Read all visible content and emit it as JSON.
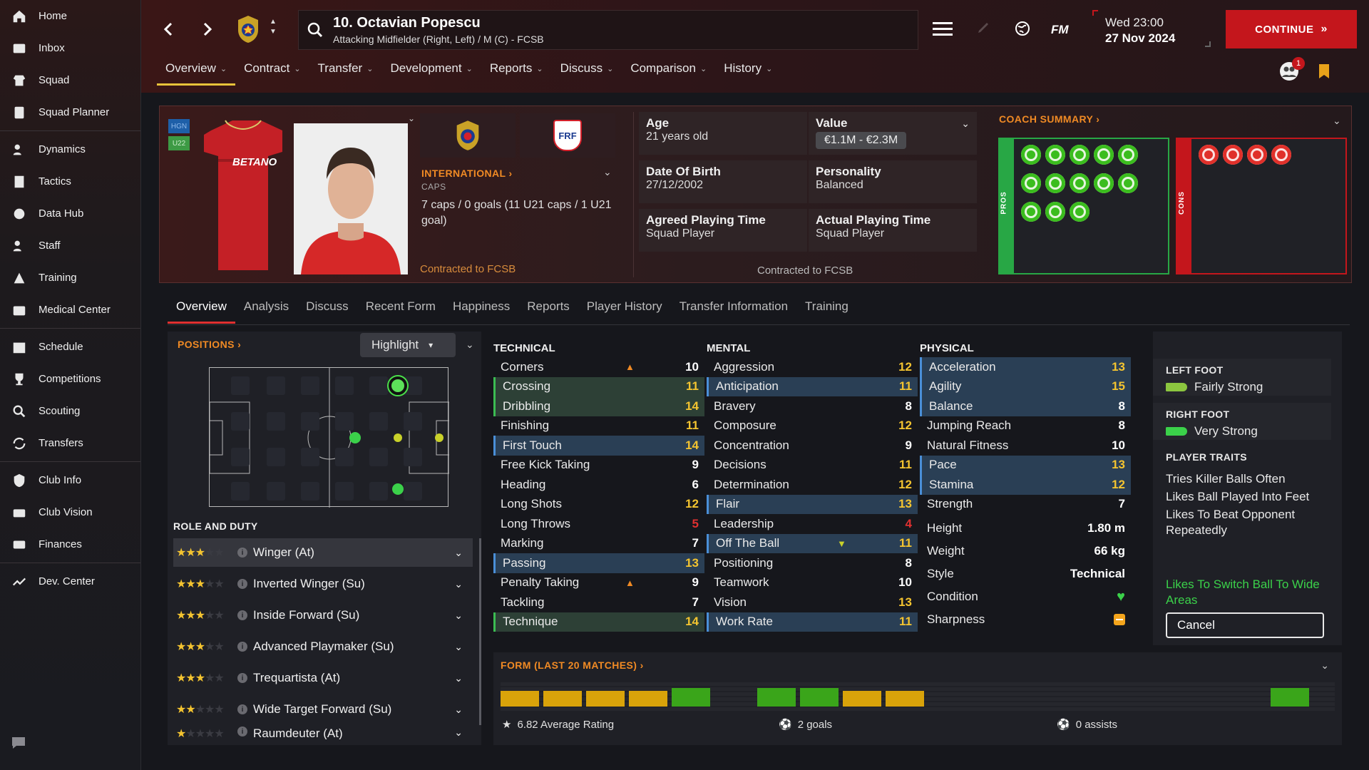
{
  "sidebar": {
    "items": [
      {
        "label": "Home",
        "icon": "home-icon"
      },
      {
        "label": "Inbox",
        "icon": "inbox-icon"
      },
      {
        "label": "Squad",
        "icon": "squad-icon"
      },
      {
        "label": "Squad Planner",
        "icon": "clipboard-icon"
      },
      {
        "label": "Dynamics",
        "icon": "dynamics-icon"
      },
      {
        "label": "Tactics",
        "icon": "tactics-icon"
      },
      {
        "label": "Data Hub",
        "icon": "data-hub-icon"
      },
      {
        "label": "Staff",
        "icon": "staff-icon"
      },
      {
        "label": "Training",
        "icon": "training-icon"
      },
      {
        "label": "Medical Center",
        "icon": "medical-icon"
      },
      {
        "label": "Schedule",
        "icon": "calendar-icon"
      },
      {
        "label": "Competitions",
        "icon": "trophy-icon"
      },
      {
        "label": "Scouting",
        "icon": "scouting-icon"
      },
      {
        "label": "Transfers",
        "icon": "transfers-icon"
      },
      {
        "label": "Club Info",
        "icon": "shield-icon"
      },
      {
        "label": "Club Vision",
        "icon": "vision-icon"
      },
      {
        "label": "Finances",
        "icon": "finances-icon"
      },
      {
        "label": "Dev. Center",
        "icon": "dev-center-icon"
      }
    ]
  },
  "header": {
    "player_name": "10. Octavian Popescu",
    "player_subtitle": "Attacking Midfielder (Right, Left) / M (C) - FCSB",
    "fm_label": "FM",
    "date_day": "Wed 23:00",
    "date_full": "27 Nov 2024",
    "continue_label": "CONTINUE",
    "notification_count": "1",
    "tabs": [
      "Overview",
      "Contract",
      "Transfer",
      "Development",
      "Reports",
      "Discuss",
      "Comparison",
      "History"
    ]
  },
  "profile": {
    "badge_hgn": "HGN",
    "badge_u22": "U22",
    "shirt_sponsor": "BETANO",
    "international_label": "INTERNATIONAL",
    "caps_label": "CAPS",
    "caps_value": "7 caps / 0 goals (11 U21 caps / 1 U21 goal)",
    "contracted_left": "Contracted to FCSB",
    "age_label": "Age",
    "age_value": "21 years old",
    "value_label": "Value",
    "value_value": "€1.1M - €2.3M",
    "dob_label": "Date Of Birth",
    "dob_value": "27/12/2002",
    "personality_label": "Personality",
    "personality_value": "Balanced",
    "agreed_pt_label": "Agreed Playing Time",
    "agreed_pt_value": "Squad Player",
    "actual_pt_label": "Actual Playing Time",
    "actual_pt_value": "Squad Player",
    "contracted_mid": "Contracted to FCSB",
    "coach_summary_label": "COACH SUMMARY",
    "pros_label": "PROS",
    "cons_label": "CONS",
    "frf_label": "FRF"
  },
  "subtabs": [
    "Overview",
    "Analysis",
    "Discuss",
    "Recent Form",
    "Happiness",
    "Reports",
    "Player History",
    "Transfer Information",
    "Training"
  ],
  "positions": {
    "label": "POSITIONS",
    "highlight_label": "Highlight",
    "role_duty_label": "ROLE AND DUTY",
    "roles": [
      {
        "name": "Winger (At)",
        "stars": 3
      },
      {
        "name": "Inverted Winger (Su)",
        "stars": 3
      },
      {
        "name": "Inside Forward (Su)",
        "stars": 3
      },
      {
        "name": "Advanced Playmaker (Su)",
        "stars": 3
      },
      {
        "name": "Trequartista (At)",
        "stars": 2.5
      },
      {
        "name": "Wide Target Forward (Su)",
        "stars": 1.5
      },
      {
        "name": "Raumdeuter (At)",
        "stars": 1
      }
    ]
  },
  "attributes": {
    "technical_label": "TECHNICAL",
    "mental_label": "MENTAL",
    "physical_label": "PHYSICAL",
    "technical": [
      {
        "name": "Corners",
        "value": "10",
        "hl": "",
        "arrow": "up"
      },
      {
        "name": "Crossing",
        "value": "11",
        "hl": "green"
      },
      {
        "name": "Dribbling",
        "value": "14",
        "hl": "green"
      },
      {
        "name": "Finishing",
        "value": "11",
        "hl": ""
      },
      {
        "name": "First Touch",
        "value": "14",
        "hl": "blue"
      },
      {
        "name": "Free Kick Taking",
        "value": "9",
        "hl": ""
      },
      {
        "name": "Heading",
        "value": "6",
        "hl": ""
      },
      {
        "name": "Long Shots",
        "value": "12",
        "hl": ""
      },
      {
        "name": "Long Throws",
        "value": "5",
        "hl": ""
      },
      {
        "name": "Marking",
        "value": "7",
        "hl": ""
      },
      {
        "name": "Passing",
        "value": "13",
        "hl": "blue"
      },
      {
        "name": "Penalty Taking",
        "value": "9",
        "hl": "",
        "arrow": "up"
      },
      {
        "name": "Tackling",
        "value": "7",
        "hl": ""
      },
      {
        "name": "Technique",
        "value": "14",
        "hl": "green"
      }
    ],
    "mental": [
      {
        "name": "Aggression",
        "value": "12",
        "hl": ""
      },
      {
        "name": "Anticipation",
        "value": "11",
        "hl": "blue"
      },
      {
        "name": "Bravery",
        "value": "8",
        "hl": ""
      },
      {
        "name": "Composure",
        "value": "12",
        "hl": ""
      },
      {
        "name": "Concentration",
        "value": "9",
        "hl": ""
      },
      {
        "name": "Decisions",
        "value": "11",
        "hl": ""
      },
      {
        "name": "Determination",
        "value": "12",
        "hl": ""
      },
      {
        "name": "Flair",
        "value": "13",
        "hl": "blue"
      },
      {
        "name": "Leadership",
        "value": "4",
        "hl": ""
      },
      {
        "name": "Off The Ball",
        "value": "11",
        "hl": "blue",
        "arrow": "down"
      },
      {
        "name": "Positioning",
        "value": "8",
        "hl": ""
      },
      {
        "name": "Teamwork",
        "value": "10",
        "hl": ""
      },
      {
        "name": "Vision",
        "value": "13",
        "hl": ""
      },
      {
        "name": "Work Rate",
        "value": "11",
        "hl": "blue"
      }
    ],
    "physical": [
      {
        "name": "Acceleration",
        "value": "13",
        "hl": "blue"
      },
      {
        "name": "Agility",
        "value": "15",
        "hl": "blue"
      },
      {
        "name": "Balance",
        "value": "8",
        "hl": "blue"
      },
      {
        "name": "Jumping Reach",
        "value": "8",
        "hl": ""
      },
      {
        "name": "Natural Fitness",
        "value": "10",
        "hl": ""
      },
      {
        "name": "Pace",
        "value": "13",
        "hl": "blue"
      },
      {
        "name": "Stamina",
        "value": "12",
        "hl": "blue"
      },
      {
        "name": "Strength",
        "value": "7",
        "hl": ""
      }
    ],
    "extra": [
      {
        "name": "Height",
        "value": "1.80 m"
      },
      {
        "name": "Weight",
        "value": "66 kg"
      },
      {
        "name": "Style",
        "value": "Technical"
      }
    ],
    "condition_label": "Condition",
    "sharpness_label": "Sharpness"
  },
  "traits": {
    "left_foot_label": "LEFT FOOT",
    "left_foot_value": "Fairly Strong",
    "right_foot_label": "RIGHT FOOT",
    "right_foot_value": "Very Strong",
    "player_traits_label": "PLAYER TRAITS",
    "items": [
      "Tries Killer Balls Often",
      "Likes Ball Played Into Feet",
      "Likes To Beat Opponent Repeatedly"
    ],
    "pending": "Likes To Switch Ball To Wide Areas",
    "cancel_label": "Cancel"
  },
  "form": {
    "label": "FORM (LAST 20 MATCHES)",
    "average_rating": "6.82 Average Rating",
    "goals": "2 goals",
    "assists": "0 assists",
    "bars": [
      "yellow",
      "yellow",
      "yellow",
      "yellow",
      "green",
      "empty",
      "green",
      "green",
      "yellow",
      "yellow",
      "empty",
      "empty",
      "empty",
      "empty",
      "empty",
      "empty",
      "empty",
      "empty",
      "green",
      "empty"
    ]
  },
  "colors": {
    "accent_red": "#c4161c",
    "orange": "#f08a24",
    "green": "#3bbd52",
    "yellow": "#f4c430",
    "form_yellow": "#d9a30a",
    "form_green": "#3aa51a"
  }
}
